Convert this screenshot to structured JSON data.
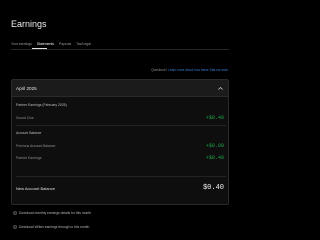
{
  "page": {
    "title": "Earnings"
  },
  "tabs": [
    {
      "label": "Your earnings",
      "active": false
    },
    {
      "label": "Statements",
      "active": true
    },
    {
      "label": "Payouts",
      "active": false
    },
    {
      "label": "Tax/Legal",
      "active": false
    }
  ],
  "help": {
    "prefix": "Questions? ",
    "link": "Learn more about how these Stat.ms work"
  },
  "statement": {
    "period": "April 2025",
    "partner_section": "Partner Earnings (February 2025)",
    "partner_rows": [
      {
        "label": "Sound Clue",
        "value": "+$0.40"
      }
    ],
    "account_section": "Account Balance",
    "account_rows": [
      {
        "label": "Previous Account Balance",
        "value": "+$0.00"
      },
      {
        "label": "Partner Earnings",
        "value": "+$0.40"
      }
    ],
    "new_balance_label": "New Account Balance",
    "new_balance_value": "$0.40"
  },
  "downloads": {
    "monthly": "Download monthly earnings details for this month",
    "earnings": "Download Writes earnings through to this month"
  },
  "colors": {
    "positive": "#1fa54a",
    "link": "#3c7bd6",
    "background": "#000000"
  }
}
